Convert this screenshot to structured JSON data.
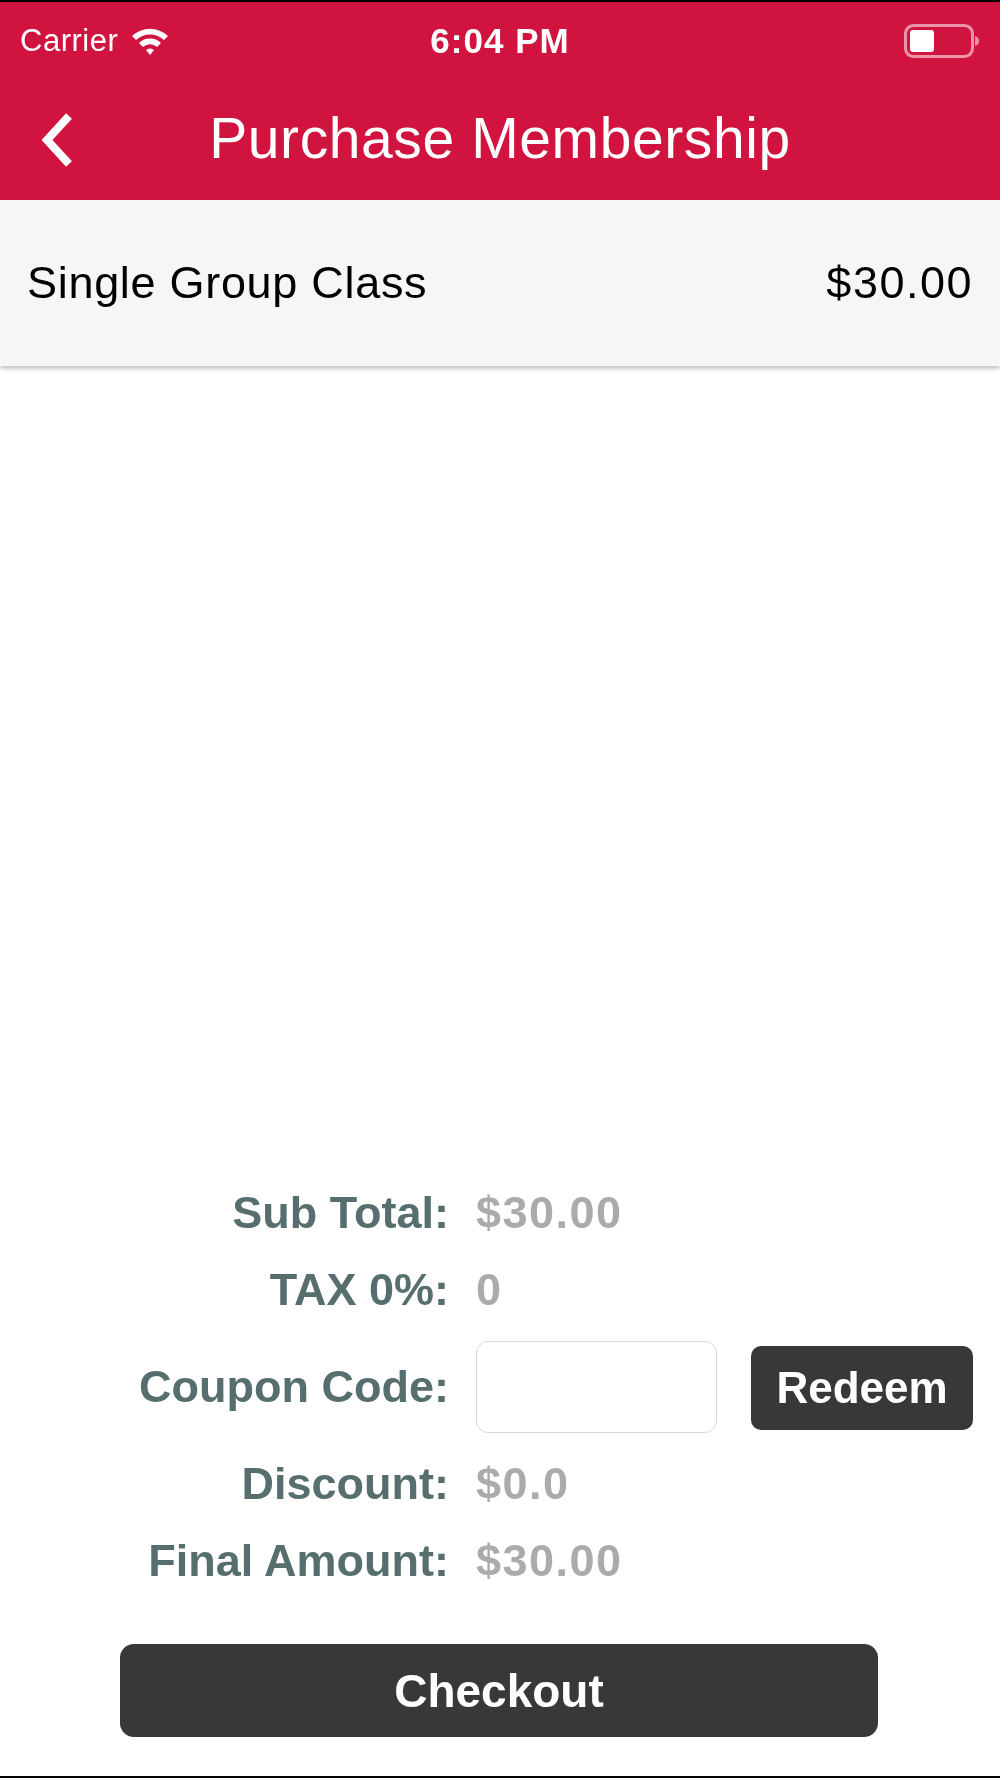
{
  "status_bar": {
    "carrier": "Carrier",
    "time": "6:04 PM"
  },
  "header": {
    "title": "Purchase Membership"
  },
  "items": [
    {
      "name": "Single Group Class",
      "price": "$30.00"
    }
  ],
  "summary": [
    {
      "kind": "text",
      "label": "Sub Total:",
      "value": "$30.00"
    },
    {
      "kind": "text",
      "label": "TAX 0%:",
      "value": "0"
    },
    {
      "kind": "coupon",
      "label": "Coupon Code:",
      "button": "Redeem"
    },
    {
      "kind": "text",
      "label": "Discount:",
      "value": "$0.0"
    },
    {
      "kind": "text",
      "label": "Final Amount:",
      "value": "$30.00"
    }
  ],
  "checkout_button": "Checkout"
}
